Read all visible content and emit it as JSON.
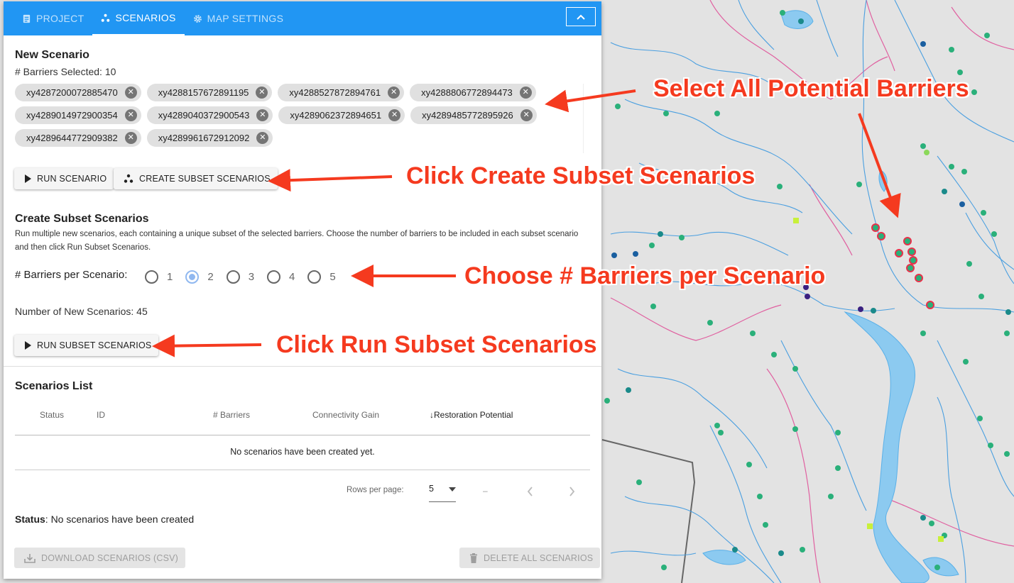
{
  "tabs": [
    {
      "label": "PROJECT",
      "icon": "clipboard-icon",
      "active": false
    },
    {
      "label": "SCENARIOS",
      "icon": "scatter-dots-icon",
      "active": true
    },
    {
      "label": "MAP SETTINGS",
      "icon": "gear-icon",
      "active": false
    }
  ],
  "new_scenario": {
    "title": "New Scenario",
    "barriers_selected": "# Barriers Selected: 10",
    "barriers": [
      "xy4287200072885470",
      "xy4288157672891195",
      "xy4288527872894761",
      "xy4288806772894473",
      "xy4289014972900354",
      "xy4289040372900543",
      "xy4289062372894651",
      "xy4289485772895926",
      "xy4289644772909382",
      "xy4289961672912092"
    ],
    "run_scenario_label": "RUN SCENARIO",
    "create_subset_label": "CREATE SUBSET SCENARIOS"
  },
  "subset": {
    "title": "Create Subset Scenarios",
    "description": "Run multiple new scenarios, each containing a unique subset of the selected barriers. Choose the number of barriers to be included in each subset scenario and then click Run Subset Scenarios.",
    "barriers_per_label": "# Barriers per Scenario:",
    "options": [
      "1",
      "2",
      "3",
      "4",
      "5"
    ],
    "selected": "2",
    "new_scenarios_count": "Number of New Scenarios: 45",
    "run_subset_label": "RUN SUBSET SCENARIOS"
  },
  "scenarios_list": {
    "title": "Scenarios List",
    "columns": [
      "Status",
      "ID",
      "# Barriers",
      "Connectivity Gain",
      "Restoration Potential"
    ],
    "sorted_column_prefix": "↓",
    "empty_message": "No scenarios have been created yet.",
    "rows_per_page_label": "Rows per page:",
    "rows_per_page_value": "5",
    "range_text": "–"
  },
  "status": {
    "label": "Status",
    "text": ": No scenarios have been created"
  },
  "footer": {
    "download_label": "DOWNLOAD SCENARIOS (CSV)",
    "delete_label": "DELETE ALL SCENARIOS"
  },
  "annotations": {
    "select_all": "Select All Potential Barriers",
    "click_create": "Click Create Subset Scenarios",
    "choose_num": "Choose # Barriers per Scenario",
    "click_run": "Click Run Subset Scenarios"
  },
  "colors": {
    "tab_bar": "#2196f3",
    "annotation": "#f53a1f",
    "river": "#4a9fe0",
    "lake": "#8ccaf0",
    "boundary": "#e060a0",
    "map_bg": "#e3e3e3"
  }
}
